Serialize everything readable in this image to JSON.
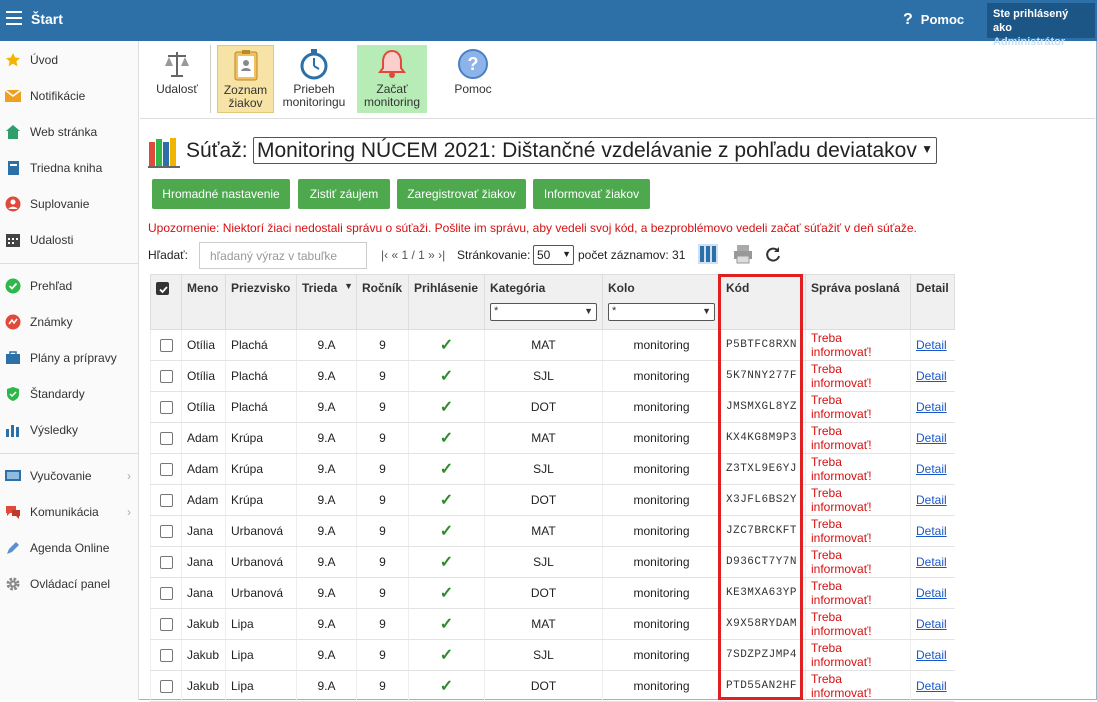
{
  "header": {
    "title": "Štart",
    "help": "Pomoc",
    "user_line1": "Ste prihlásený ako",
    "user_line2": "Administrátor"
  },
  "sidebar": {
    "items": [
      {
        "label": "Úvod",
        "icon": "star-icon",
        "color": "#f2b400"
      },
      {
        "label": "Notifikácie",
        "icon": "envelope-icon",
        "color": "#f0a020"
      },
      {
        "label": "Web stránka",
        "icon": "home-icon",
        "color": "#2e9e6a"
      },
      {
        "label": "Triedna kniha",
        "icon": "book-icon",
        "color": "#2d70a8"
      },
      {
        "label": "Suplovanie",
        "icon": "user-icon",
        "color": "#e04a3c"
      },
      {
        "label": "Udalosti",
        "icon": "calendar-icon",
        "color": "#444444"
      },
      {
        "label": "Prehľad",
        "icon": "check-circle-icon",
        "color": "#2eb84a"
      },
      {
        "label": "Známky",
        "icon": "chart-circle-icon",
        "color": "#e04a3c"
      },
      {
        "label": "Plány a prípravy",
        "icon": "briefcase-icon",
        "color": "#2d70a8"
      },
      {
        "label": "Štandardy",
        "icon": "shield-icon",
        "color": "#2eb84a"
      },
      {
        "label": "Výsledky",
        "icon": "bar-chart-icon",
        "color": "#2d70a8"
      },
      {
        "label": "Vyučovanie",
        "icon": "board-icon",
        "color": "#2d70a8"
      },
      {
        "label": "Komunikácia",
        "icon": "chat-icon",
        "color": "#e04a3c"
      },
      {
        "label": "Agenda Online",
        "icon": "pen-icon",
        "color": "#2d70a8"
      },
      {
        "label": "Ovládací panel",
        "icon": "cog-icon",
        "color": "#888888"
      }
    ]
  },
  "toolbar": {
    "udalost": "Udalosť",
    "zoznam_1": "Zoznam",
    "zoznam_2": "žiakov",
    "priebeh_1": "Priebeh",
    "priebeh_2": "monitoringu",
    "zacat_1": "Začať",
    "zacat_2": "monitoring",
    "pomoc": "Pomoc"
  },
  "competition": {
    "label": "Súťaž:",
    "selected": "Monitoring NÚCEM 2021: Dištančné vzdelávanie z pohľadu deviatakov"
  },
  "actions": {
    "bulk": "Hromadné nastavenie",
    "interest": "Zistiť záujem",
    "register": "Zaregistrovať žiakov",
    "inform": "Informovať žiakov"
  },
  "warning": "Upozornenie: Niektorí žiaci nedostali správu o súťaži. Pošlite im správu, aby vedeli svoj kód, a bezproblémovo vedeli začať súťažiť v deň súťaže.",
  "search": {
    "label": "Hľadať:",
    "placeholder": "hľadaný výraz v tabuľke"
  },
  "pager": {
    "text": "|‹ « 1 / 1 » ›|",
    "paging_label": "Stránkovanie:",
    "page_size": "50",
    "count": "počet záznamov: 31"
  },
  "table": {
    "headers": {
      "meno": "Meno",
      "priezvisko": "Priezvisko",
      "trieda": "Trieda",
      "rocnik": "Ročník",
      "prihlasenie": "Prihlásenie",
      "kategoria": "Kategória",
      "kolo": "Kolo",
      "kod": "Kód",
      "sprava": "Správa poslaná",
      "detail": "Detail"
    },
    "filter_all": "*",
    "rows": [
      {
        "meno": "Otília",
        "priezvisko": "Plachá",
        "trieda": "9.A",
        "rocnik": "9",
        "kategoria": "MAT",
        "kolo": "monitoring",
        "kod": "P5BTFC8RXN",
        "sprava": "Treba informovať!",
        "detail": "Detail"
      },
      {
        "meno": "Otília",
        "priezvisko": "Plachá",
        "trieda": "9.A",
        "rocnik": "9",
        "kategoria": "SJL",
        "kolo": "monitoring",
        "kod": "5K7NNY277F",
        "sprava": "Treba informovať!",
        "detail": "Detail"
      },
      {
        "meno": "Otília",
        "priezvisko": "Plachá",
        "trieda": "9.A",
        "rocnik": "9",
        "kategoria": "DOT",
        "kolo": "monitoring",
        "kod": "JMSMXGL8YZ",
        "sprava": "Treba informovať!",
        "detail": "Detail"
      },
      {
        "meno": "Adam",
        "priezvisko": "Krúpa",
        "trieda": "9.A",
        "rocnik": "9",
        "kategoria": "MAT",
        "kolo": "monitoring",
        "kod": "KX4KG8M9P3",
        "sprava": "Treba informovať!",
        "detail": "Detail"
      },
      {
        "meno": "Adam",
        "priezvisko": "Krúpa",
        "trieda": "9.A",
        "rocnik": "9",
        "kategoria": "SJL",
        "kolo": "monitoring",
        "kod": "Z3TXL9E6YJ",
        "sprava": "Treba informovať!",
        "detail": "Detail"
      },
      {
        "meno": "Adam",
        "priezvisko": "Krúpa",
        "trieda": "9.A",
        "rocnik": "9",
        "kategoria": "DOT",
        "kolo": "monitoring",
        "kod": "X3JFL6BS2Y",
        "sprava": "Treba informovať!",
        "detail": "Detail"
      },
      {
        "meno": "Jana",
        "priezvisko": "Urbanová",
        "trieda": "9.A",
        "rocnik": "9",
        "kategoria": "MAT",
        "kolo": "monitoring",
        "kod": "JZC7BRCKFT",
        "sprava": "Treba informovať!",
        "detail": "Detail"
      },
      {
        "meno": "Jana",
        "priezvisko": "Urbanová",
        "trieda": "9.A",
        "rocnik": "9",
        "kategoria": "SJL",
        "kolo": "monitoring",
        "kod": "D936CT7Y7N",
        "sprava": "Treba informovať!",
        "detail": "Detail"
      },
      {
        "meno": "Jana",
        "priezvisko": "Urbanová",
        "trieda": "9.A",
        "rocnik": "9",
        "kategoria": "DOT",
        "kolo": "monitoring",
        "kod": "KE3MXA63YP",
        "sprava": "Treba informovať!",
        "detail": "Detail"
      },
      {
        "meno": "Jakub",
        "priezvisko": "Lipa",
        "trieda": "9.A",
        "rocnik": "9",
        "kategoria": "MAT",
        "kolo": "monitoring",
        "kod": "X9X58RYDAM",
        "sprava": "Treba informovať!",
        "detail": "Detail"
      },
      {
        "meno": "Jakub",
        "priezvisko": "Lipa",
        "trieda": "9.A",
        "rocnik": "9",
        "kategoria": "SJL",
        "kolo": "monitoring",
        "kod": "7SDZPZJMP4",
        "sprava": "Treba informovať!",
        "detail": "Detail"
      },
      {
        "meno": "Jakub",
        "priezvisko": "Lipa",
        "trieda": "9.A",
        "rocnik": "9",
        "kategoria": "DOT",
        "kolo": "monitoring",
        "kod": "PTD55AN2HF",
        "sprava": "Treba informovať!",
        "detail": "Detail"
      }
    ]
  }
}
